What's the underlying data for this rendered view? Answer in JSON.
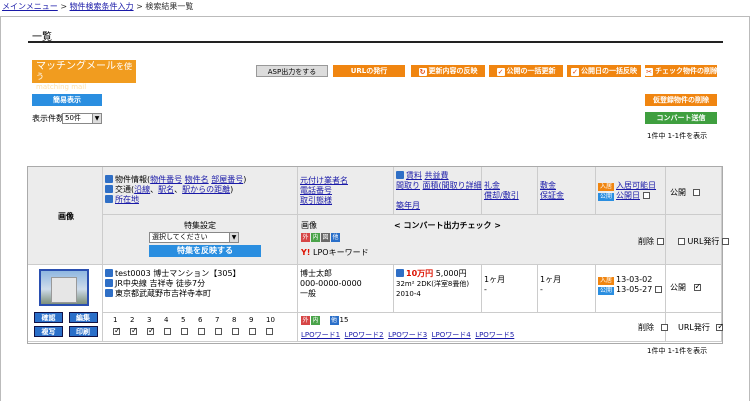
{
  "breadcrumb": {
    "home": "メインメニュー",
    "sep1": ">",
    "search_input": "物件検索条件入力",
    "sep2": ">",
    "current": "検索結果一覧"
  },
  "page_title": "一覧",
  "matching": {
    "label": "マッチングメール",
    "label_suffix": "を使う",
    "sub": "matching mail"
  },
  "top_buttons": {
    "asp_output": "ASP出力をする",
    "url_issue": "URLの発行",
    "reflect_updates": "更新内容の反映",
    "bulk_publish_update": "公開の一括更新",
    "bulk_publish_date_reflect": "公開日の一括反映",
    "check_delete": "チェック物件の削除",
    "temp_delete": "仮登録物件の削除",
    "convert_send": "コンバート送信"
  },
  "simple_view": "簡易表示",
  "per_page": {
    "label": "表示件数",
    "value": "50件"
  },
  "count_top": "1件中 1-1件を表示",
  "count_bottom": "1件中 1-1件を表示",
  "header": {
    "image": "画像",
    "info_prefix": "物件情報(",
    "info_num": "物件番号",
    "info_name": "物件名",
    "info_room": "部屋番号",
    "info_suffix": ")",
    "traffic_prefix": "交通(",
    "traffic_line": "沿線",
    "traffic_station": "駅名",
    "traffic_walk": "駅からの距離",
    "traffic_suffix": ")",
    "address": "所在地",
    "agent_name": "元付け業者名",
    "phone": "電話番号",
    "trade": "取引態様",
    "rent": "賃料",
    "common_fee": "共益費",
    "layout": "間取り",
    "area": "面積(間取り詳細)",
    "built": "築年月",
    "key_money": "礼金",
    "deposit": "敷金",
    "security": "保証金",
    "amort": "償却/敷引",
    "movein_tag": "入居",
    "movein": "入居可能日",
    "publish_tag": "公開",
    "publish_date": "公開日",
    "publish": "公開",
    "feature_setting": "特集設定",
    "feature_select": "選択してください",
    "feature_apply": "特集を反映する",
    "image_label": "画像",
    "convert_check": "< コンバート出力チェック >",
    "lpo_keyword": "LPOキーワード",
    "delete": "削除",
    "url_issue": "URL発行"
  },
  "row": {
    "id": "test0003",
    "name": "博士マンション【305】",
    "line": "JR中央線",
    "station": "吉祥寺",
    "walk": "徒歩7分",
    "address": "東京都武蔵野市吉祥寺本町",
    "agent": "博士太郎",
    "phone": "000-0000-0000",
    "trade": "一般",
    "rent": "10万円",
    "common": "5,000円",
    "area_layout": "32m² 2DK(洋室8畳他)",
    "built": "2010-4",
    "key_money": "1ヶ月",
    "key_sub": "-",
    "deposit": "1ヶ月",
    "deposit_sub": "-",
    "movein_date": "13-03-02",
    "publish_date": "13-05-27",
    "publish": "公開",
    "image_count": "15",
    "actions": [
      "確認",
      "編集",
      "複写",
      "印刷"
    ],
    "feature_nums": [
      "1",
      "2",
      "3",
      "4",
      "5",
      "6",
      "7",
      "8",
      "9",
      "10"
    ],
    "feature_checked": [
      true,
      true,
      true,
      false,
      false,
      false,
      false,
      false,
      false,
      false
    ],
    "lpo": [
      "LPOワード1",
      "LPOワード2",
      "LPOワード3",
      "LPOワード4",
      "LPOワード5"
    ],
    "delete": "削除",
    "url_issue": "URL発行"
  },
  "mini_icons": {
    "out": "外",
    "in": "内",
    "map": "図",
    "etc": "他"
  },
  "colors": {
    "orange": "#f08510",
    "blue": "#2a8ee0",
    "green": "#3f9f3f",
    "link": "#1a1aa8"
  }
}
